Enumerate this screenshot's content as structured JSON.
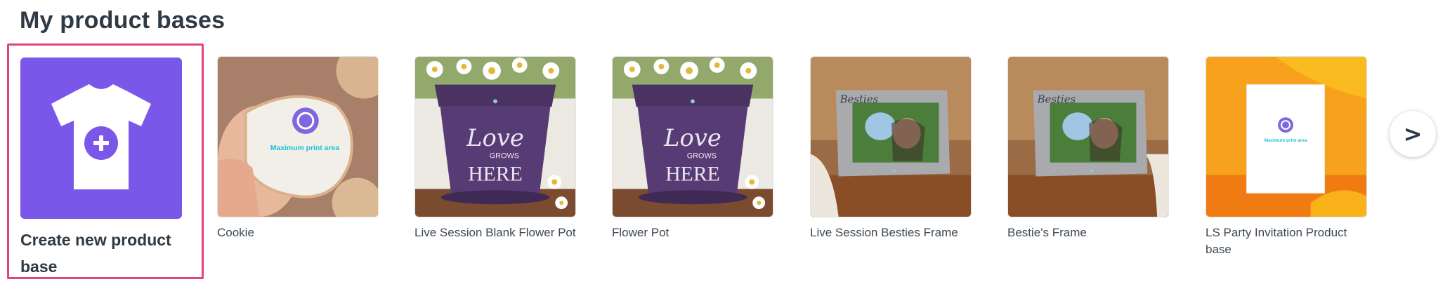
{
  "page": {
    "title": "My product bases"
  },
  "create_card": {
    "label": "Create new product base",
    "icon": "tshirt-plus-icon"
  },
  "products": [
    {
      "label": "Cookie",
      "print_area_text": "Maximum print area"
    },
    {
      "label": "Live Session Blank Flower Pot",
      "pot_text_1": "Love",
      "pot_text_2": "GROWS",
      "pot_text_3": "HERE"
    },
    {
      "label": "Flower Pot",
      "pot_text_1": "Love",
      "pot_text_2": "GROWS",
      "pot_text_3": "HERE"
    },
    {
      "label": "Live Session Besties Frame",
      "frame_text": "Besties"
    },
    {
      "label": "Bestie's Frame",
      "frame_text": "Besties"
    },
    {
      "label": "LS Party Invitation Product base",
      "print_area_text": "Maximum print area"
    }
  ],
  "navigation": {
    "next_label": ">"
  },
  "colors": {
    "accent_purple": "#7a57e8",
    "selection_border": "#e0457b",
    "print_area_cyan": "#19c1d6"
  }
}
